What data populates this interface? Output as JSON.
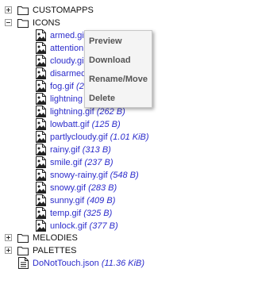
{
  "tree": {
    "top_folders": [
      {
        "label": "CUSTOMAPPS",
        "state": "collapsed"
      },
      {
        "label": "ICONS",
        "state": "expanded"
      }
    ],
    "icons_files": [
      {
        "name": "armed.gif",
        "size": ""
      },
      {
        "name": "attention",
        "size": ""
      },
      {
        "name": "cloudy.gi",
        "size": ""
      },
      {
        "name": "disarmed",
        "size": ""
      },
      {
        "name": "fog.gif",
        "size": "(2"
      },
      {
        "name": "lightning",
        "size": ""
      },
      {
        "name": "lightning.gif",
        "size": "(262 B)"
      },
      {
        "name": "lowbatt.gif",
        "size": "(125 B)"
      },
      {
        "name": "partlycloudy.gif",
        "size": "(1.01 KiB)"
      },
      {
        "name": "rainy.gif",
        "size": "(313 B)"
      },
      {
        "name": "smile.gif",
        "size": "(237 B)"
      },
      {
        "name": "snowy-rainy.gif",
        "size": "(548 B)"
      },
      {
        "name": "snowy.gif",
        "size": "(283 B)"
      },
      {
        "name": "sunny.gif",
        "size": "(409 B)"
      },
      {
        "name": "temp.gif",
        "size": "(325 B)"
      },
      {
        "name": "unlock.gif",
        "size": "(377 B)"
      }
    ],
    "bottom_folders": [
      {
        "label": "MELODIES",
        "state": "collapsed"
      },
      {
        "label": "PALETTES",
        "state": "collapsed"
      }
    ],
    "root_file": {
      "name": "DoNotTouch.json",
      "size": "(11.36 KiB)"
    }
  },
  "context_menu": {
    "items": [
      "Preview",
      "Download",
      "Rename/Move",
      "Delete"
    ]
  },
  "colors": {
    "link": "#2c2ccc",
    "menu_text": "#555555",
    "menu_bg": "#f4f4f4"
  },
  "icons": {
    "toggle_collapsed": "plus-box-icon",
    "toggle_expanded": "minus-box-icon",
    "folder": "folder-icon",
    "image_file": "image-file-icon",
    "text_file": "text-file-icon"
  }
}
